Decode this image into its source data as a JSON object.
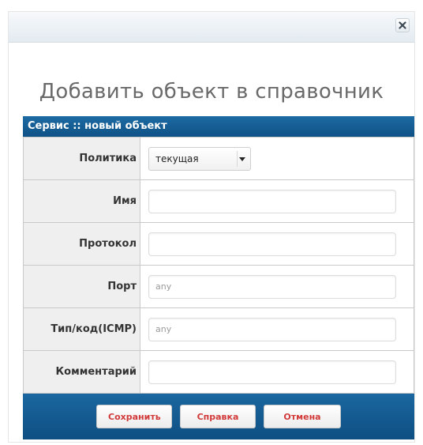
{
  "dialog": {
    "heading": "Добавить объект в справочник"
  },
  "panel": {
    "title": "Сервис :: новый объект"
  },
  "form": {
    "policy": {
      "label": "Политика",
      "selected": "текущая"
    },
    "name": {
      "label": "Имя",
      "value": "",
      "placeholder": ""
    },
    "protocol": {
      "label": "Протокол",
      "value": "",
      "placeholder": ""
    },
    "port": {
      "label": "Порт",
      "value": "",
      "placeholder": "any"
    },
    "icmp": {
      "label": "Тип/код(ICMP)",
      "value": "",
      "placeholder": "any"
    },
    "comment": {
      "label": "Комментарий",
      "value": "",
      "placeholder": ""
    }
  },
  "buttons": {
    "save": "Сохранить",
    "help": "Справка",
    "cancel": "Отмена"
  },
  "icons": {
    "close": "close-icon",
    "dropdown": "dropdown-arrow-icon"
  },
  "colors": {
    "header_blue": "#1d6aa3",
    "button_text": "#d23a3a",
    "label_bg": "#efefef"
  }
}
